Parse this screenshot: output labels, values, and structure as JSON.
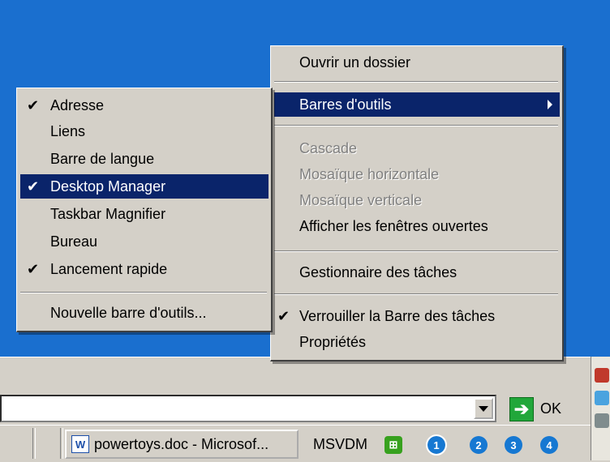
{
  "context_menu": {
    "items": [
      {
        "label": "Ouvrir un dossier"
      },
      {
        "label": "Barres d'outils"
      },
      {
        "label": "Cascade"
      },
      {
        "label": "Mosaïque horizontale"
      },
      {
        "label": "Mosaïque verticale"
      },
      {
        "label": "Afficher les fenêtres ouvertes"
      },
      {
        "label": "Gestionnaire des tâches"
      },
      {
        "label": "Verrouiller la Barre des tâches"
      },
      {
        "label": "Propriétés"
      }
    ]
  },
  "toolbars_submenu": {
    "items": [
      {
        "label": "Adresse",
        "checked": true
      },
      {
        "label": "Liens",
        "checked": false
      },
      {
        "label": "Barre de langue",
        "checked": false
      },
      {
        "label": "Desktop Manager",
        "checked": true
      },
      {
        "label": "Taskbar Magnifier",
        "checked": false
      },
      {
        "label": "Bureau",
        "checked": false
      },
      {
        "label": "Lancement rapide",
        "checked": true
      },
      {
        "label": "Nouvelle barre d'outils...",
        "checked": false
      }
    ]
  },
  "address_bar": {
    "go_label": "OK"
  },
  "taskbar": {
    "task_button_label": "powertoys.doc - Microsof...",
    "word_icon_glyph": "W",
    "desktop_manager_label": "MSVDM",
    "virtual_desktops": [
      "1",
      "2",
      "3",
      "4"
    ]
  },
  "colors": {
    "desktop": "#1a6fcf",
    "menu_bg": "#d4d0c8",
    "highlight": "#0a246a"
  }
}
